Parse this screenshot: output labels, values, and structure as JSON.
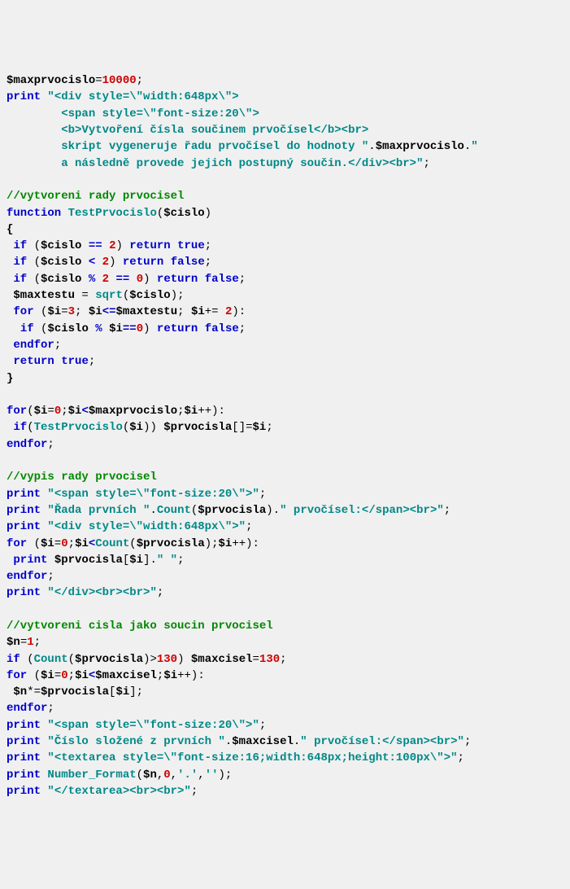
{
  "code": {
    "l01": {
      "a": "$maxprvocislo",
      "b": "=",
      "c": "10000",
      "d": ";"
    },
    "l02": {
      "a": "print",
      "b": " ",
      "c": "\"<div style=\\\"width:648px\\\">"
    },
    "l03": {
      "a": "        <span style=\\\"font-size:20\\\">"
    },
    "l04": {
      "a": "        <b>Vytvoření čísla součinem prvočísel</b><br>"
    },
    "l05": {
      "a": "        skript vygeneruje řadu prvočísel do hodnoty \"",
      "b": ".",
      "c": "$maxprvocislo",
      "d": ".",
      "e": "\""
    },
    "l06": {
      "a": "        a následně provede jejich postupný součin.</div><br>\"",
      "b": ";"
    },
    "l07": {
      "a": "//vytvoreni rady prvocisel"
    },
    "l08": {
      "a": "function",
      "b": " ",
      "c": "TestPrvocislo",
      "d": "(",
      "e": "$cislo",
      "f": ")"
    },
    "l09": {
      "a": "{"
    },
    "l10": {
      "a": " ",
      "b": "if",
      "c": " (",
      "d": "$cislo",
      "e": " ",
      "f": "==",
      "g": " ",
      "h": "2",
      "i": ") ",
      "j": "return",
      "k": " ",
      "l": "true",
      "m": ";"
    },
    "l11": {
      "a": " ",
      "b": "if",
      "c": " (",
      "d": "$cislo",
      "e": " ",
      "f": "<",
      "g": " ",
      "h": "2",
      "i": ") ",
      "j": "return",
      "k": " ",
      "l": "false",
      "m": ";"
    },
    "l12": {
      "a": " ",
      "b": "if",
      "c": " (",
      "d": "$cislo",
      "e": " ",
      "f": "%",
      "g": " ",
      "h": "2",
      "i": " ",
      "j": "==",
      "k": " ",
      "l": "0",
      "m": ") ",
      "n": "return",
      "o": " ",
      "p": "false",
      "q": ";"
    },
    "l13": {
      "a": " ",
      "b": "$maxtestu",
      "c": " = ",
      "d": "sqrt",
      "e": "(",
      "f": "$cislo",
      "g": ");"
    },
    "l14": {
      "a": " ",
      "b": "for",
      "c": " (",
      "d": "$i",
      "e": "=",
      "f": "3",
      "g": "; ",
      "h": "$i",
      "i": "<=",
      "j": "$maxtestu",
      "k": "; ",
      "l": "$i",
      "m": "+= ",
      "n": "2",
      "o": "):"
    },
    "l15": {
      "a": "  ",
      "b": "if",
      "c": " (",
      "d": "$cislo",
      "e": " ",
      "f": "%",
      "g": " ",
      "h": "$i",
      "i": "==",
      "j": "0",
      "k": ") ",
      "l": "return",
      "m": " ",
      "n": "false",
      "o": ";"
    },
    "l16": {
      "a": " ",
      "b": "endfor",
      "c": ";"
    },
    "l17": {
      "a": " ",
      "b": "return",
      "c": " ",
      "d": "true",
      "e": ";"
    },
    "l18": {
      "a": "}"
    },
    "l19": {
      "a": "for",
      "b": "(",
      "c": "$i",
      "d": "=",
      "e": "0",
      "f": ";",
      "g": "$i",
      "h": "<",
      "i": "$maxprvocislo",
      "j": ";",
      "k": "$i",
      "l": "++):"
    },
    "l20": {
      "a": " ",
      "b": "if",
      "c": "(",
      "d": "TestPrvocislo",
      "e": "(",
      "f": "$i",
      "g": ")) ",
      "h": "$prvocisla",
      "i": "[]=",
      "j": "$i",
      "k": ";"
    },
    "l21": {
      "a": "endfor",
      "b": ";"
    },
    "l22": {
      "a": "//vypis rady prvocisel"
    },
    "l23": {
      "a": "print",
      "b": " ",
      "c": "\"<span style=\\\"font-size:20\\\">\"",
      "d": ";"
    },
    "l24": {
      "a": "print",
      "b": " ",
      "c": "\"Řada prvních \"",
      "d": ".",
      "e": "Count",
      "f": "(",
      "g": "$prvocisla",
      "h": ").",
      "i": "\" prvočísel:</span><br>\"",
      "j": ";"
    },
    "l25": {
      "a": "print",
      "b": " ",
      "c": "\"<div style=\\\"width:648px\\\">\"",
      "d": ";"
    },
    "l26": {
      "a": "for",
      "b": " (",
      "c": "$i",
      "d": "=",
      "e": "0",
      "f": ";",
      "g": "$i",
      "h": "<",
      "i": "Count",
      "j": "(",
      "k": "$prvocisla",
      "l": ");",
      "m": "$i",
      "n": "++):"
    },
    "l27": {
      "a": " ",
      "b": "print",
      "c": " ",
      "d": "$prvocisla",
      "e": "[",
      "f": "$i",
      "g": "].",
      "h": "\" \"",
      "i": ";"
    },
    "l28": {
      "a": "endfor",
      "b": ";"
    },
    "l29": {
      "a": "print",
      "b": " ",
      "c": "\"</div><br><br>\"",
      "d": ";"
    },
    "l30": {
      "a": "//vytvoreni cisla jako soucin prvocisel"
    },
    "l31": {
      "a": "$n",
      "b": "=",
      "c": "1",
      "d": ";"
    },
    "l32": {
      "a": "if",
      "b": " (",
      "c": "Count",
      "d": "(",
      "e": "$prvocisla",
      "f": ")>",
      "g": "130",
      "h": ") ",
      "i": "$maxcisel",
      "j": "=",
      "k": "130",
      "l": ";"
    },
    "l33": {
      "a": "for",
      "b": " (",
      "c": "$i",
      "d": "=",
      "e": "0",
      "f": ";",
      "g": "$i",
      "h": "<",
      "i": "$maxcisel",
      "j": ";",
      "k": "$i",
      "l": "++):"
    },
    "l34": {
      "a": " ",
      "b": "$n",
      "c": "*=",
      "d": "$prvocisla",
      "e": "[",
      "f": "$i",
      "g": "];"
    },
    "l35": {
      "a": "endfor",
      "b": ";"
    },
    "l36": {
      "a": "print",
      "b": " ",
      "c": "\"<span style=\\\"font-size:20\\\">\"",
      "d": ";"
    },
    "l37": {
      "a": "print",
      "b": " ",
      "c": "\"Číslo složené z prvních \"",
      "d": ".",
      "e": "$maxcisel",
      "f": ".",
      "g": "\" prvočísel:</span><br>\"",
      "h": ";"
    },
    "l38": {
      "a": "print",
      "b": " ",
      "c": "\"<textarea style=\\\"font-size:16;width:648px;height:100px\\\">\"",
      "d": ";"
    },
    "l39": {
      "a": "print",
      "b": " ",
      "c": "Number_Format",
      "d": "(",
      "e": "$n",
      "f": ",",
      "g": "0",
      "h": ",",
      "i": "'.'",
      "j": ",",
      "k": "''",
      "l": ");"
    },
    "l40": {
      "a": "print",
      "b": " ",
      "c": "\"</textarea><br><br>\"",
      "d": ";"
    }
  }
}
